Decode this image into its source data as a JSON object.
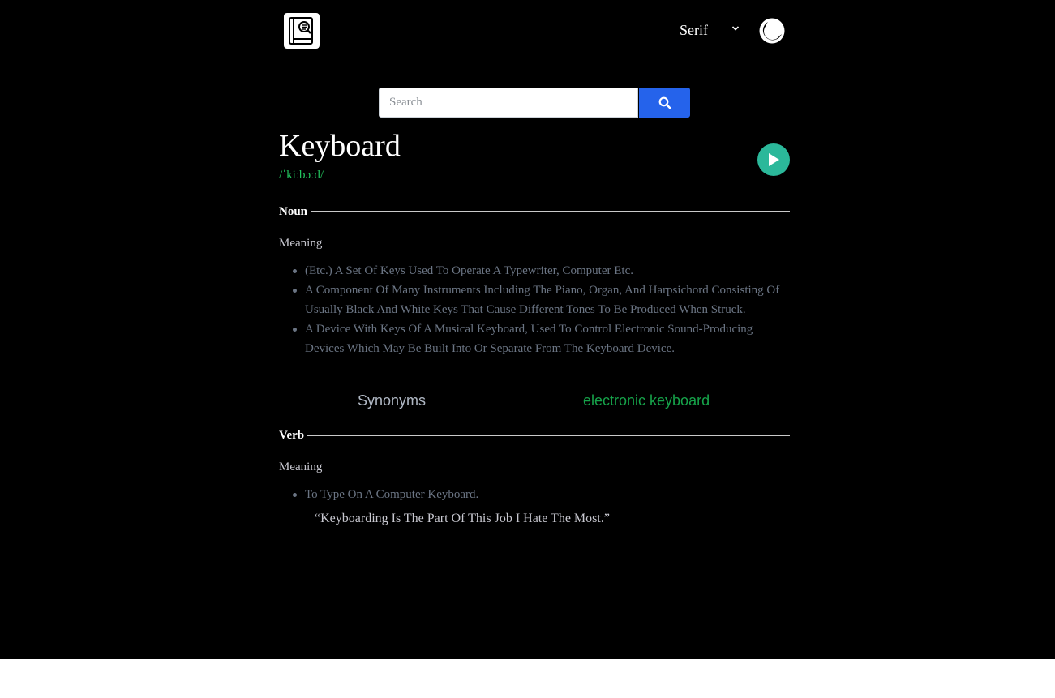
{
  "header": {
    "logo_icon": "dictionary-book-search-icon",
    "font_select": {
      "value": "Serif",
      "icon": "chevron-down-icon"
    },
    "theme_toggle_icon": "moon-icon"
  },
  "search": {
    "placeholder": "Search",
    "value": "",
    "button_icon": "search-icon",
    "button_color": "#2563eb"
  },
  "entry": {
    "word": "Keyboard",
    "phonetic": "/ˈkiːbɔːd/",
    "play_icon": "play-icon",
    "play_color": "#2bb89a",
    "accent_color": "#22c55e",
    "meanings": [
      {
        "part_of_speech": "Noun",
        "meaning_label": "Meaning",
        "definitions": [
          "(Etc.) A Set Of Keys Used To Operate A Typewriter, Computer Etc.",
          "A Component Of Many Instruments Including The Piano, Organ, And Harpsichord Consisting Of Usually Black And White Keys That Cause Different Tones To Be Produced When Struck.",
          "A Device With Keys Of A Musical Keyboard, Used To Control Electronic Sound-Producing Devices Which May Be Built Into Or Separate From The Keyboard Device."
        ],
        "synonyms_label": "Synonyms",
        "synonyms": [
          "electronic keyboard"
        ]
      },
      {
        "part_of_speech": "Verb",
        "meaning_label": "Meaning",
        "definitions": [
          "To Type On A Computer Keyboard."
        ],
        "example": "“Keyboarding Is The Part Of This Job I Hate The Most.”"
      }
    ]
  }
}
